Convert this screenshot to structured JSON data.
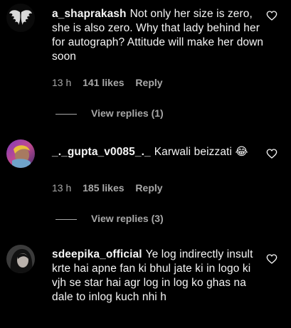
{
  "comments": [
    {
      "username": "a_shaprakash",
      "text": "Not only her size is zero, she is also zero. Why that lady behind her for autograph? Attitude will make her down soon",
      "time": "13 h",
      "likes": "141 likes",
      "reply": "Reply",
      "view_replies": "View replies (1)",
      "avatar": "angel-wings-avatar"
    },
    {
      "username": "_._gupta_v0085_._",
      "text": "Karwali beizzati 😂",
      "time": "13 h",
      "likes": "185 likes",
      "reply": "Reply",
      "view_replies": "View replies (3)",
      "avatar": "colorful-portrait-avatar"
    },
    {
      "username": "sdeepika_official",
      "text": "Ye log indirectly insult krte hai apne fan ki bhul jate ki in logo ki vjh se star hai agr log in log ko ghas na dale to inlog kuch nhi h",
      "avatar": "woman-portrait-avatar"
    }
  ],
  "icons": {
    "like": "heart-outline-icon"
  },
  "colors": {
    "background": "#000000",
    "text": "#f5f5f5",
    "secondary": "#a8a8a8"
  }
}
